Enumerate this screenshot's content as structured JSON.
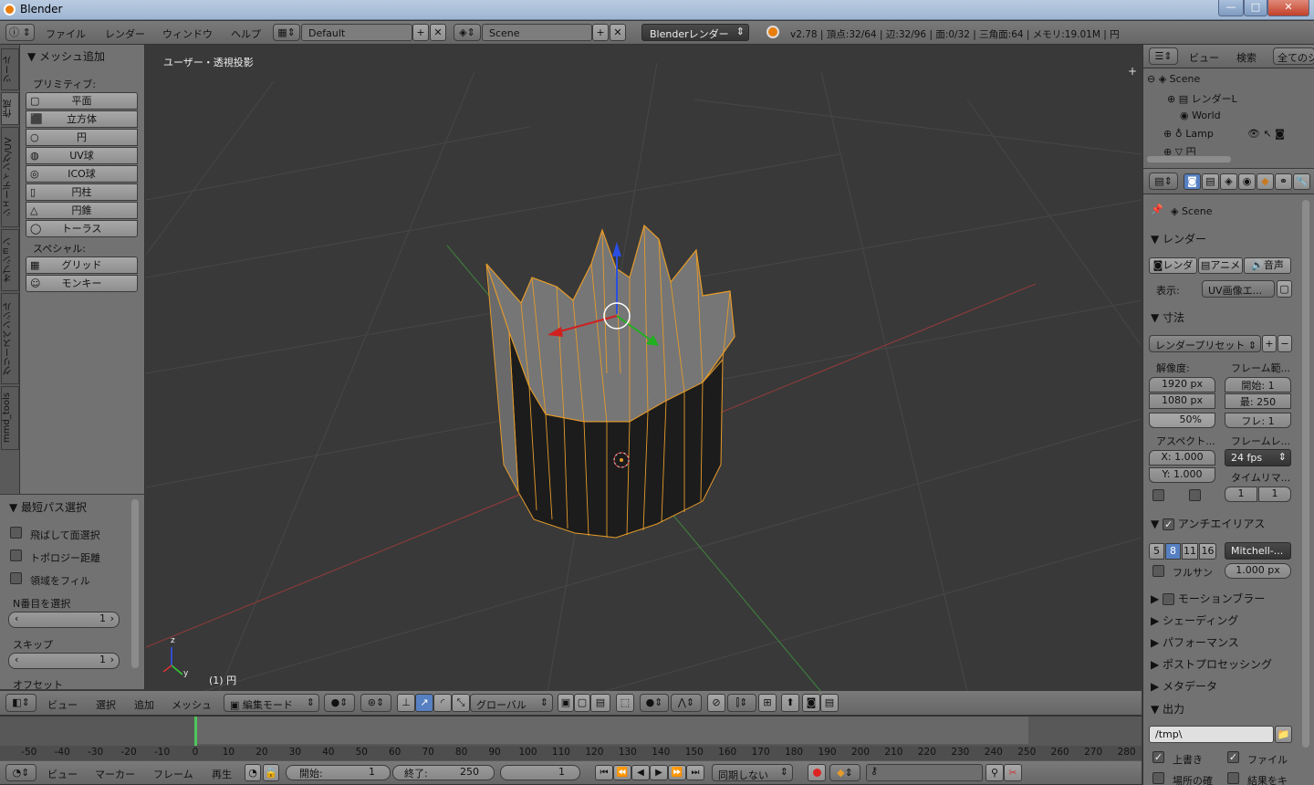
{
  "window": {
    "title": "Blender",
    "min": "—",
    "max": "□",
    "close": "✕"
  },
  "topbar": {
    "menus": [
      "ファイル",
      "レンダー",
      "ウィンドウ",
      "ヘルプ"
    ],
    "layout": "Default",
    "scene": "Scene",
    "engine": "Blenderレンダー",
    "stats": "v2.78 | 頂点:32/64 | 辺:32/96 | 面:0/32 | 三角面:64 | メモリ:19.01M | 円"
  },
  "left_tabs": [
    "ツール",
    "作成",
    "シェーディング/UV",
    "オプション",
    "グリースペンシル",
    "mmd_tools"
  ],
  "tool_panel": {
    "header": "メッシュ追加",
    "primitive_label": "プリミティブ:",
    "primitives": [
      "平面",
      "立方体",
      "円",
      "UV球",
      "ICO球",
      "円柱",
      "円錐",
      "トーラス"
    ],
    "special_label": "スペシャル:",
    "specials": [
      "グリッド",
      "モンキー"
    ]
  },
  "operator_panel": {
    "header": "最短パス選択",
    "options": [
      "飛ばして面選択",
      "トポロジー距離",
      "領域をフィル"
    ],
    "nth_label": "N番目を選択",
    "nth_value": "1",
    "skip_label": "スキップ",
    "skip_value": "1",
    "offset_label": "オフセット"
  },
  "viewport": {
    "view_name": "ユーザー・透視投影",
    "object_label": "(1) 円",
    "axis_z": "z",
    "axis_y": "y"
  },
  "view3d_header": {
    "menus": [
      "ビュー",
      "選択",
      "追加",
      "メッシュ"
    ],
    "mode": "編集モード",
    "orientation": "グローバル"
  },
  "timeline": {
    "ticks": [
      "-50",
      "-40",
      "-30",
      "-20",
      "-10",
      "0",
      "10",
      "20",
      "30",
      "40",
      "50",
      "60",
      "70",
      "80",
      "90",
      "100",
      "110",
      "120",
      "130",
      "140",
      "150",
      "160",
      "170",
      "180",
      "190",
      "200",
      "210",
      "220",
      "230",
      "240",
      "250",
      "260",
      "270",
      "280"
    ],
    "menus": [
      "ビュー",
      "マーカー",
      "フレーム",
      "再生"
    ],
    "start_label": "開始:",
    "start_value": "1",
    "end_label": "終了:",
    "end_value": "250",
    "current": "1",
    "sync": "同期しない"
  },
  "outliner": {
    "menus": [
      "ビュー",
      "検索",
      "全てのシ"
    ],
    "items": [
      "Scene",
      "レンダーL",
      "World",
      "Lamp",
      "円"
    ]
  },
  "properties": {
    "scene": "Scene",
    "render_header": "レンダー",
    "render_buttons": [
      "レンダ",
      "アニメ",
      "音声"
    ],
    "display_label": "表示:",
    "display_value": "UV画像エ...",
    "dimensions_header": "寸法",
    "preset": "レンダープリセット",
    "resolution_label": "解像度:",
    "frame_range_label": "フレーム範...",
    "res_x": "1920 px",
    "res_y": "1080 px",
    "res_pct": "50%",
    "frame_start": "開始:   1",
    "frame_end": "最:  250",
    "frame_step": "フレ:   1",
    "aspect_label": "アスペクト...",
    "framerate_label": "フレームレ...",
    "aspect_x": "X: 1.000",
    "aspect_y": "Y: 1.000",
    "fps": "24 fps",
    "time_remap_label": "タイムリマ...",
    "remap_old": "1",
    "remap_new": "1",
    "aa_header": "アンチエイリアス",
    "aa_samples": [
      "5",
      "8",
      "11",
      "16"
    ],
    "aa_filter": "Mitchell-...",
    "full_sample": "フルサン",
    "filter_size": "1.000 px",
    "motion_blur": "モーションブラー",
    "collapsed_sections": [
      "シェーディング",
      "パフォーマンス",
      "ポストプロセッシング",
      "メタデータ"
    ],
    "output_header": "出力",
    "output_path": "/tmp\\",
    "overwrite": "上書き",
    "file_ext": "ファイル",
    "placeholders": "場所の確",
    "cache": "結果をキ"
  },
  "colors": {
    "accent": "#e59b2a",
    "select_blue": "#5680c2",
    "viewport_bg": "#3a3a3a"
  }
}
